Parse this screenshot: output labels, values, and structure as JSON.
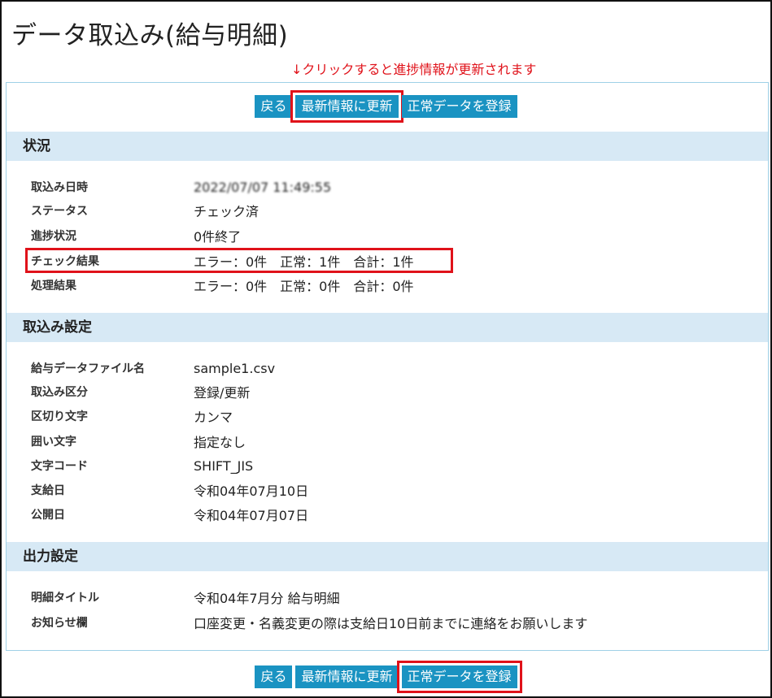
{
  "page": {
    "title": "データ取込み(給与明細)",
    "annotation": "↓クリックすると進捗情報が更新されます"
  },
  "top_buttons": {
    "back": "戻る",
    "refresh": "最新情報に更新",
    "register": "正常データを登録"
  },
  "status_section": {
    "heading": "状況",
    "rows": [
      {
        "label": "取込み日時",
        "value": "2022/07/07 11:49:55"
      },
      {
        "label": "ステータス",
        "value": "チェック済"
      },
      {
        "label": "進捗状況",
        "value": "0件終了"
      },
      {
        "label": "チェック結果",
        "value": "エラー：0件　正常：1件　合計：1件"
      },
      {
        "label": "処理結果",
        "value": "エラー：0件　正常：0件　合計：0件"
      }
    ]
  },
  "import_section": {
    "heading": "取込み設定",
    "rows": [
      {
        "label": "給与データファイル名",
        "value": "sample1.csv"
      },
      {
        "label": "取込み区分",
        "value": "登録/更新"
      },
      {
        "label": "区切り文字",
        "value": "カンマ"
      },
      {
        "label": "囲い文字",
        "value": "指定なし"
      },
      {
        "label": "文字コード",
        "value": "SHIFT_JIS"
      },
      {
        "label": "支給日",
        "value": "令和04年07月10日"
      },
      {
        "label": "公開日",
        "value": "令和04年07月07日"
      }
    ]
  },
  "output_section": {
    "heading": "出力設定",
    "rows": [
      {
        "label": "明細タイトル",
        "value": "令和04年7月分 給与明細"
      },
      {
        "label": "お知らせ欄",
        "value": "口座変更・名義変更の際は支給日10日前までに連絡をお願いします"
      }
    ]
  },
  "bottom_buttons": {
    "back": "戻る",
    "refresh": "最新情報に更新",
    "register": "正常データを登録"
  },
  "colors": {
    "button": "#1a93c2",
    "section_header": "#d7e9f5",
    "highlight": "#e0121a",
    "panel_border": "#9fd0e6"
  }
}
